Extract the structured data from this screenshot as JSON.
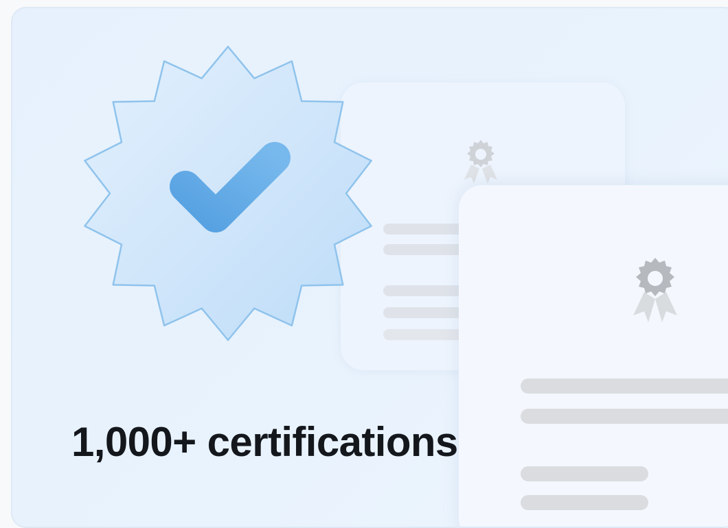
{
  "promo_card": {
    "headline": "1,000+ certifications",
    "badge_icon": "verified-check-badge-icon",
    "certificate_icon": "award-ribbon-icon"
  },
  "colors": {
    "card_background": "#e7f2fd",
    "badge_fill": "#cfe6fb",
    "badge_outline": "#8fc3ec",
    "checkmark": "#5aa7e4",
    "certificate_surface": "#f4f8fe",
    "placeholder_line": "#dadcdf",
    "award_icon": "#b6b9bd",
    "headline_text": "#14171c"
  }
}
